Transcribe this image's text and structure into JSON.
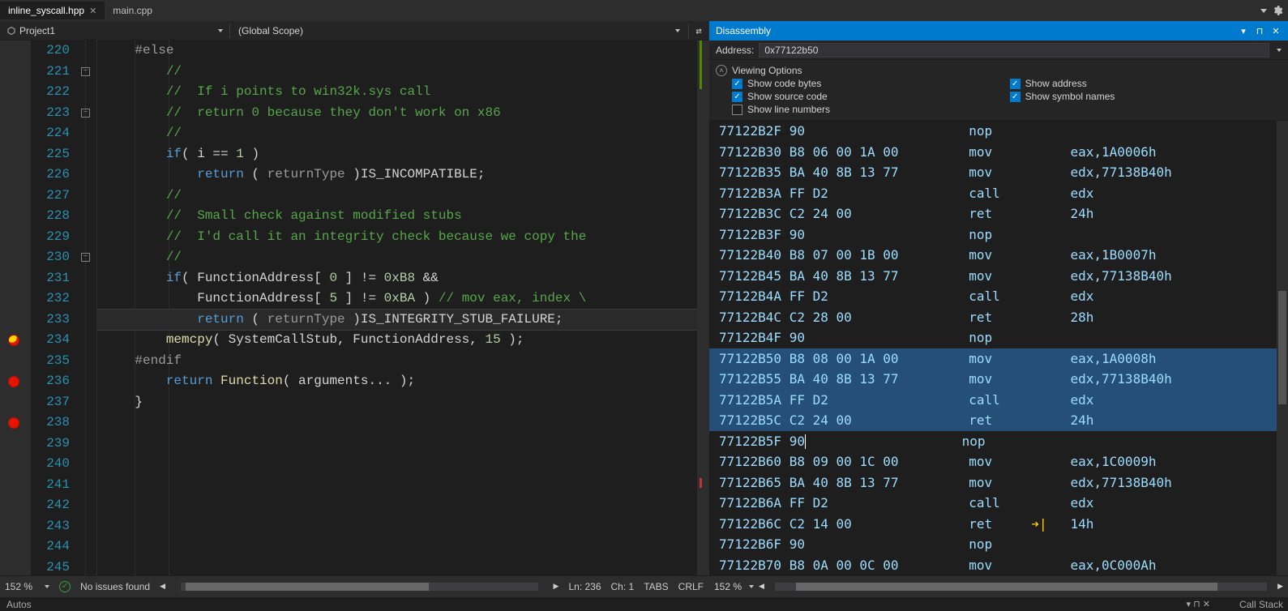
{
  "tabs": {
    "active": "inline_syscall.hpp",
    "other": "main.cpp"
  },
  "scopes": {
    "project": "Project1",
    "mid": "(Global Scope)",
    "right": "⇄"
  },
  "lines": {
    "start": 220,
    "items": [
      {
        "n": 220,
        "t": ""
      },
      {
        "n": 221,
        "t": "    #else",
        "cls": "pp"
      },
      {
        "n": 222,
        "t": ""
      },
      {
        "n": 223,
        "t": "        //",
        "cls": "cm"
      },
      {
        "n": 224,
        "t": "        //  If i points to win32k.sys call",
        "cls": "cm"
      },
      {
        "n": 225,
        "t": "        //  return 0 because they don't work on x86",
        "cls": "cm"
      },
      {
        "n": 226,
        "t": "        //",
        "cls": "cm"
      },
      {
        "n": 227,
        "t": "        if( i == 1 )",
        "hl": "kwif"
      },
      {
        "n": 228,
        "t": "            return ( returnType )IS_INCOMPATIBLE;",
        "hl": "kwret"
      },
      {
        "n": 229,
        "t": ""
      },
      {
        "n": 230,
        "t": "        //",
        "cls": "cm"
      },
      {
        "n": 231,
        "t": "        //  Small check against modified stubs",
        "cls": "cm"
      },
      {
        "n": 232,
        "t": "        //  I'd call it an integrity check because we copy the",
        "cls": "cm"
      },
      {
        "n": 233,
        "t": "        //",
        "cls": "cm"
      },
      {
        "n": 234,
        "t": "        if( FunctionAddress[ 0 ] != 0xB8 &&",
        "hl": "kwif2",
        "bp": "yellow"
      },
      {
        "n": 235,
        "t": "            FunctionAddress[ 5 ] != 0xBA ) // mov eax, index \\",
        "hl": "cmtail"
      },
      {
        "n": 236,
        "t": "            return ( returnType )IS_INTEGRITY_STUB_FAILURE;",
        "hl": "kwret",
        "bp": "red",
        "current": true
      },
      {
        "n": 237,
        "t": ""
      },
      {
        "n": 238,
        "t": "        memcpy( SystemCallStub, FunctionAddress, 15 );",
        "hl": "call",
        "bp": "red"
      },
      {
        "n": 239,
        "t": "    #endif",
        "cls": "pp"
      },
      {
        "n": 240,
        "t": ""
      },
      {
        "n": 241,
        "t": "        return Function( arguments... );",
        "hl": "kwret2"
      },
      {
        "n": 242,
        "t": "    }"
      },
      {
        "n": 243,
        "t": ""
      },
      {
        "n": 244,
        "t": ""
      },
      {
        "n": 245,
        "t": ""
      }
    ]
  },
  "editorStatus": {
    "zoom": "152 %",
    "issues": "No issues found",
    "pos": {
      "ln": "Ln: 236",
      "ch": "Ch: 1",
      "tabs": "TABS",
      "crlf": "CRLF"
    }
  },
  "disasm": {
    "title": "Disassembly",
    "addressLabel": "Address:",
    "address": "0x77122b50",
    "voHead": "Viewing Options",
    "opts": {
      "codeBytes": {
        "label": "Show code bytes",
        "on": true
      },
      "address": {
        "label": "Show address",
        "on": true
      },
      "source": {
        "label": "Show source code",
        "on": true
      },
      "symbol": {
        "label": "Show symbol names",
        "on": true
      },
      "lineNums": {
        "label": "Show line numbers",
        "on": false
      }
    },
    "lines": [
      {
        "a": "77122B2F",
        "b": "90",
        "m": "nop",
        "o": ""
      },
      {
        "a": "77122B30",
        "b": "B8 06 00 1A 00",
        "m": "mov",
        "o": "eax,1A0006h"
      },
      {
        "a": "77122B35",
        "b": "BA 40 8B 13 77",
        "m": "mov",
        "o": "edx,77138B40h"
      },
      {
        "a": "77122B3A",
        "b": "FF D2",
        "m": "call",
        "o": "edx"
      },
      {
        "a": "77122B3C",
        "b": "C2 24 00",
        "m": "ret",
        "o": "24h"
      },
      {
        "a": "77122B3F",
        "b": "90",
        "m": "nop",
        "o": ""
      },
      {
        "a": "77122B40",
        "b": "B8 07 00 1B 00",
        "m": "mov",
        "o": "eax,1B0007h"
      },
      {
        "a": "77122B45",
        "b": "BA 40 8B 13 77",
        "m": "mov",
        "o": "edx,77138B40h"
      },
      {
        "a": "77122B4A",
        "b": "FF D2",
        "m": "call",
        "o": "edx"
      },
      {
        "a": "77122B4C",
        "b": "C2 28 00",
        "m": "ret",
        "o": "28h"
      },
      {
        "a": "77122B4F",
        "b": "90",
        "m": "nop",
        "o": ""
      },
      {
        "a": "77122B50",
        "b": "B8 08 00 1A 00",
        "m": "mov",
        "o": "eax,1A0008h",
        "sel": true
      },
      {
        "a": "77122B55",
        "b": "BA 40 8B 13 77",
        "m": "mov",
        "o": "edx,77138B40h",
        "sel": true
      },
      {
        "a": "77122B5A",
        "b": "FF D2",
        "m": "call",
        "o": "edx",
        "sel": true
      },
      {
        "a": "77122B5C",
        "b": "C2 24 00",
        "m": "ret",
        "o": "24h",
        "sel": true
      },
      {
        "a": "77122B5F",
        "b": "90",
        "m": "nop",
        "o": "",
        "cursor": true
      },
      {
        "a": "77122B60",
        "b": "B8 09 00 1C 00",
        "m": "mov",
        "o": "eax,1C0009h"
      },
      {
        "a": "77122B65",
        "b": "BA 40 8B 13 77",
        "m": "mov",
        "o": "edx,77138B40h"
      },
      {
        "a": "77122B6A",
        "b": "FF D2",
        "m": "call",
        "o": "edx"
      },
      {
        "a": "77122B6C",
        "b": "C2 14 00",
        "m": "ret",
        "o": "14h",
        "arrow": true
      },
      {
        "a": "77122B6F",
        "b": "90",
        "m": "nop",
        "o": ""
      },
      {
        "a": "77122B70",
        "b": "B8 0A 00 0C 00",
        "m": "mov",
        "o": "eax,0C000Ah"
      }
    ],
    "statusZoom": "152 %"
  },
  "bottom": {
    "left": "Autos",
    "right": "Call Stack"
  }
}
